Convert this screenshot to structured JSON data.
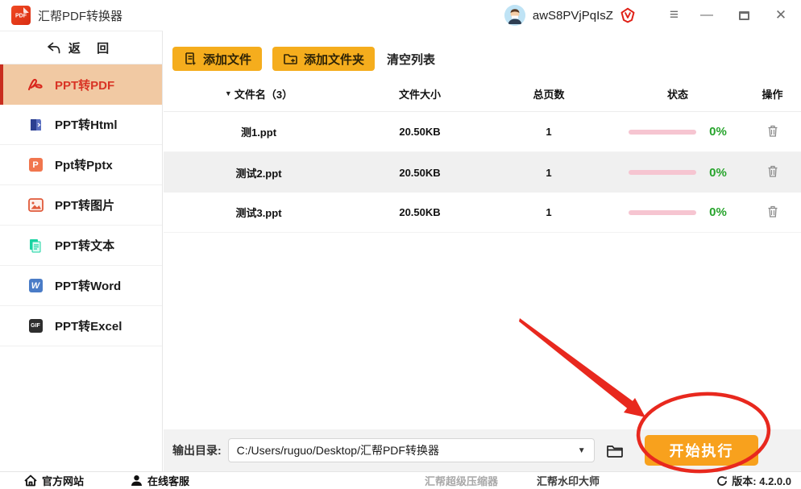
{
  "titlebar": {
    "app_title": "汇帮PDF转换器",
    "username": "awS8PVjPqIsZ",
    "menu_glyph": "≡",
    "minimize_glyph": "—",
    "close_glyph": "✕"
  },
  "sidebar": {
    "back_label": "返 回",
    "items": [
      {
        "label": "PPT转PDF",
        "selected": true,
        "icon": "acrobat-pdf-icon"
      },
      {
        "label": "PPT转Html",
        "selected": false,
        "icon": "html-book-icon"
      },
      {
        "label": "Ppt转Pptx",
        "selected": false,
        "icon": "pptx-p-icon",
        "badge": "P"
      },
      {
        "label": "PPT转图片",
        "selected": false,
        "icon": "image-icon"
      },
      {
        "label": "PPT转文本",
        "selected": false,
        "icon": "text-pages-icon"
      },
      {
        "label": "PPT转Word",
        "selected": false,
        "icon": "word-w-icon",
        "badge": "W"
      },
      {
        "label": "PPT转Excel",
        "selected": false,
        "icon": "gif-doc-icon",
        "badge": "GIF"
      }
    ]
  },
  "toolbar": {
    "add_file": "添加文件",
    "add_folder": "添加文件夹",
    "clear_list": "清空列表"
  },
  "table": {
    "headers": {
      "name": "文件名（3）",
      "size": "文件大小",
      "pages": "总页数",
      "status": "状态",
      "action": "操作",
      "sort_caret": "▼"
    },
    "rows": [
      {
        "name": "测1.ppt",
        "size": "20.50KB",
        "pages": "1",
        "percent": "0%"
      },
      {
        "name": "测试2.ppt",
        "size": "20.50KB",
        "pages": "1",
        "percent": "0%"
      },
      {
        "name": "测试3.ppt",
        "size": "20.50KB",
        "pages": "1",
        "percent": "0%"
      }
    ]
  },
  "output": {
    "label": "输出目录:",
    "path": "C:/Users/ruguo/Desktop/汇帮PDF转换器",
    "dropdown_caret": "▼",
    "start_button": "开始执行"
  },
  "footer": {
    "official_site": "官方网站",
    "online_service": "在线客服",
    "super_compressor": "汇帮超级压缩器",
    "watermark_master": "汇帮水印大师",
    "version": "版本: 4.2.0.0"
  },
  "colors": {
    "selected_item_bg": "#f1c9a3",
    "selected_item_accent": "#c92d1f",
    "selected_item_text": "#d93425",
    "toolbar_button": "#f5ad1d",
    "start_button": "#f8a11d",
    "progress_bar": "#f6c5d1",
    "percent_green": "#27a42c",
    "annotation_red": "#e8281e",
    "row_alt_bg": "#f0f0f0"
  },
  "progress": {
    "value_percent": 0
  }
}
